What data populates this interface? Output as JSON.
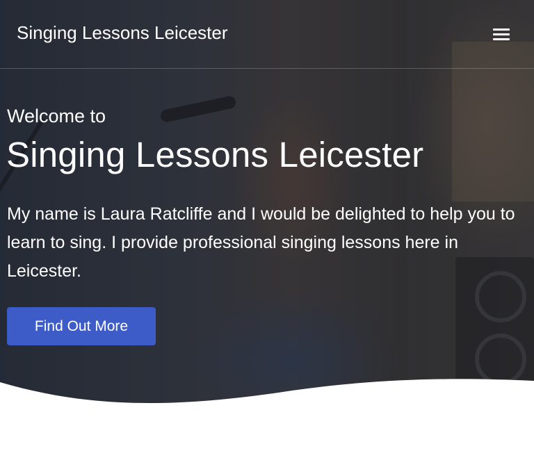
{
  "navbar": {
    "brand": "Singing Lessons Leicester",
    "menu_icon": "hamburger-menu-icon"
  },
  "hero": {
    "welcome": "Welcome to",
    "title": "Singing Lessons Leicester",
    "intro": "My name is Laura Ratcliffe and I would be delighted to help you to learn to sing. I provide professional singing lessons here in Leicester.",
    "cta_label": "Find Out More",
    "background_image": "woman-singing-with-guitar-and-microphone"
  },
  "colors": {
    "cta": "#3e5cc8",
    "text": "#ffffff",
    "page_background": "#ffffff"
  }
}
